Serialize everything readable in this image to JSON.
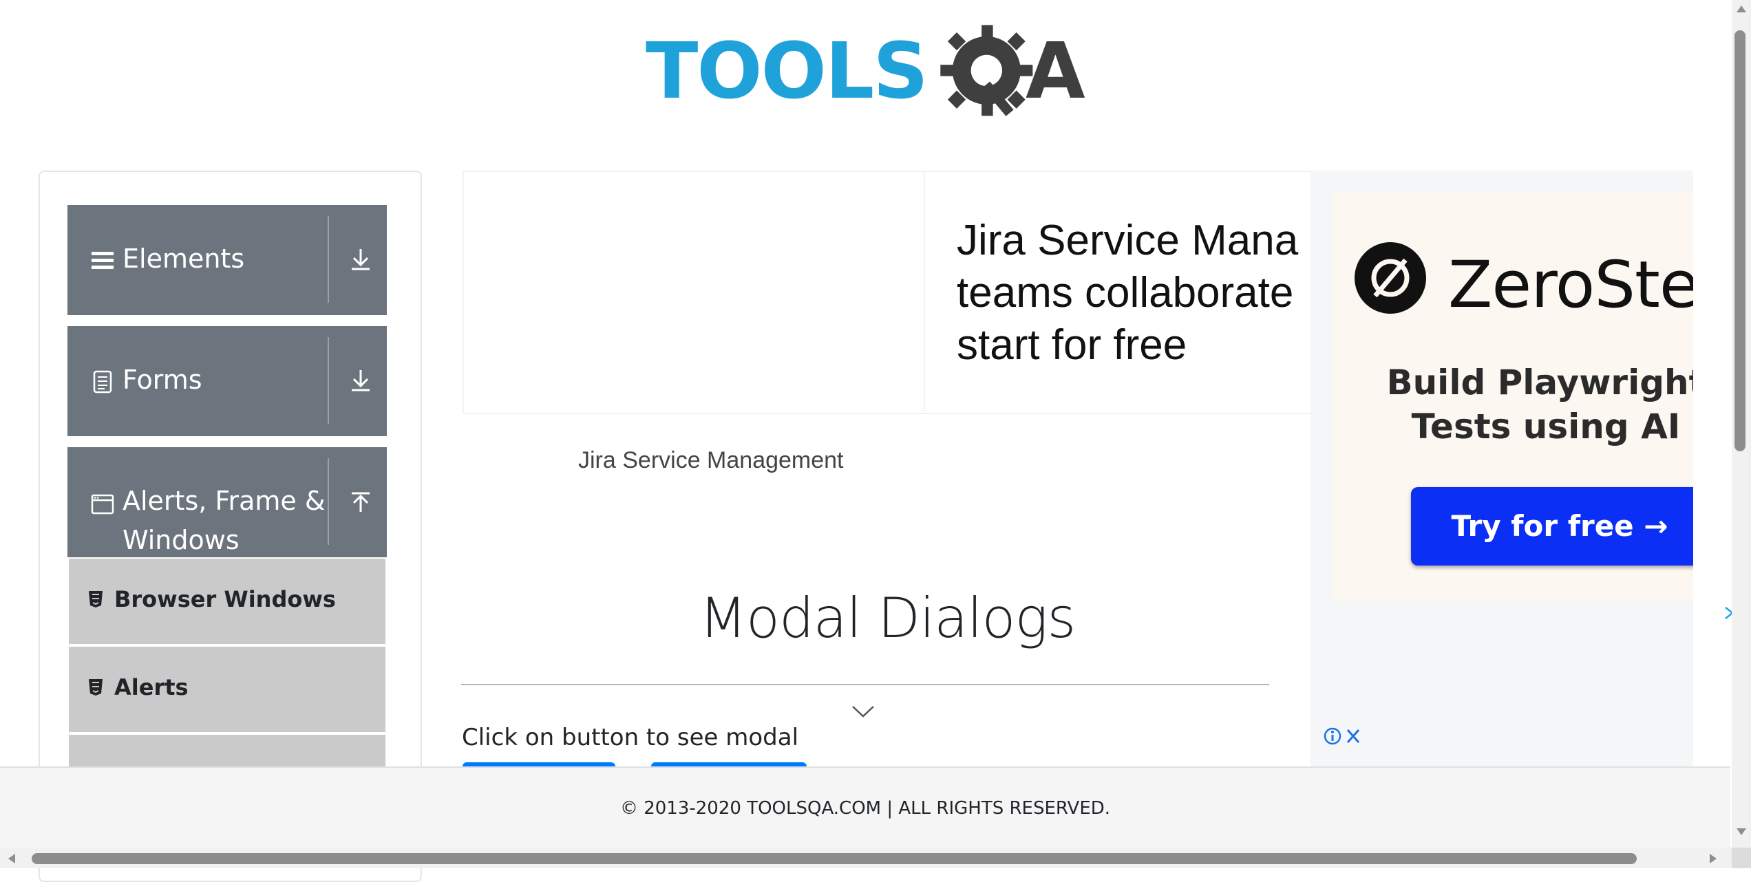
{
  "header": {
    "logo_part1": "TOOLS",
    "logo_part2": "A",
    "logo_alt": "TOOLSQA",
    "colors": {
      "tools": "#1ea2d9",
      "qa": "#3f3f3f"
    }
  },
  "sidebar": {
    "groups": [
      {
        "label": "Elements",
        "icon": "hamburger-icon",
        "arrow": "download-arrow-icon"
      },
      {
        "label": "Forms",
        "icon": "document-icon",
        "arrow": "download-arrow-icon"
      },
      {
        "label_line1": "Alerts, Frame &",
        "label_line2": "Windows",
        "icon": "window-icon",
        "arrow": "upload-arrow-icon"
      }
    ],
    "items": [
      {
        "label": "Browser Windows",
        "icon": "html5-icon"
      },
      {
        "label": "Alerts",
        "icon": "html5-icon"
      }
    ]
  },
  "ad_center": {
    "headline": "Jira Service Management helps teams collaborate at high-velocity, start for free",
    "headline_line1": "Jira Service Mana",
    "headline_line2": "teams collaborate",
    "headline_line3": "start for free",
    "brand": "Jira Service Management"
  },
  "main": {
    "title": "Modal Dialogs",
    "hint": "Click on button to see modal"
  },
  "ad_right": {
    "brand": "ZeroStep",
    "tagline_line1": "Build Playwright",
    "tagline_line2": "Tests using AI",
    "cta": "Try for free →",
    "colors": {
      "cta": "#0b2ff5",
      "bg": "#fdf7f1"
    }
  },
  "footer": {
    "text": "© 2013-2020 TOOLSQA.COM | ALL RIGHTS RESERVED."
  }
}
